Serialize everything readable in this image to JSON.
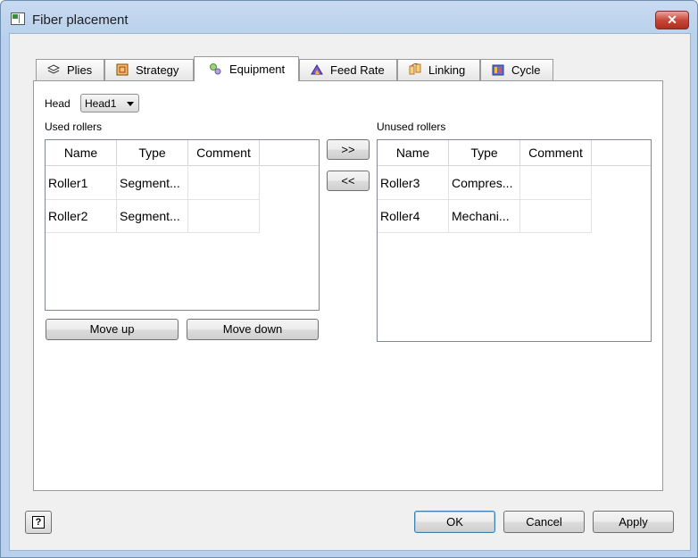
{
  "window": {
    "title": "Fiber placement",
    "close_glyph": "✕"
  },
  "tabs": [
    {
      "label": "Plies",
      "icon": "layers-icon"
    },
    {
      "label": "Strategy",
      "icon": "strategy-icon"
    },
    {
      "label": "Equipment",
      "icon": "gears-icon",
      "active": true
    },
    {
      "label": "Feed Rate",
      "icon": "feed-rate-icon"
    },
    {
      "label": "Linking",
      "icon": "linking-icon"
    },
    {
      "label": "Cycle",
      "icon": "cycle-icon"
    }
  ],
  "head": {
    "label": "Head",
    "value": "Head1"
  },
  "used": {
    "label": "Used rollers",
    "columns": [
      "Name",
      "Type",
      "Comment"
    ],
    "rows": [
      {
        "name": "Roller1",
        "type": "Segment...",
        "comment": ""
      },
      {
        "name": "Roller2",
        "type": "Segment...",
        "comment": ""
      }
    ],
    "move_up": "Move up",
    "move_down": "Move down"
  },
  "transfer": {
    "add": ">>",
    "remove": "<<"
  },
  "unused": {
    "label": "Unused rollers",
    "columns": [
      "Name",
      "Type",
      "Comment"
    ],
    "rows": [
      {
        "name": "Roller3",
        "type": "Compres...",
        "comment": ""
      },
      {
        "name": "Roller4",
        "type": "Mechani...",
        "comment": ""
      }
    ]
  },
  "footer": {
    "help": "?",
    "ok": "OK",
    "cancel": "Cancel",
    "apply": "Apply"
  }
}
